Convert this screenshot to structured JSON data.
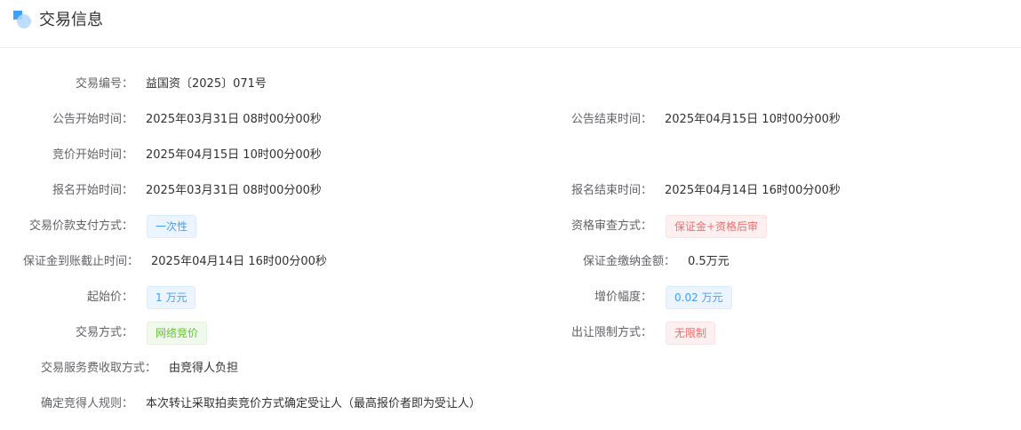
{
  "header": {
    "title": "交易信息",
    "icon": "section-block-icon",
    "accent": "#409eff"
  },
  "fields": {
    "trade_no": {
      "label": "交易编号：",
      "value": "益国资〔2025〕071号"
    },
    "notice_start": {
      "label": "公告开始时间：",
      "value": "2025年03月31日 08时00分00秒"
    },
    "notice_end": {
      "label": "公告结束时间：",
      "value": "2025年04月15日 10时00分00秒"
    },
    "bid_start": {
      "label": "竞价开始时间：",
      "value": "2025年04月15日 10时00分00秒"
    },
    "signup_start": {
      "label": "报名开始时间：",
      "value": "2025年03月31日 08时00分00秒"
    },
    "signup_end": {
      "label": "报名结束时间：",
      "value": "2025年04月14日 16时00分00秒"
    },
    "payment_method": {
      "label": "交易价款支付方式：",
      "value": "一次性"
    },
    "qualification_review": {
      "label": "资格审查方式：",
      "value": "保证金+资格后审"
    },
    "deposit_deadline": {
      "label": "保证金到账截止时间：",
      "value": "2025年04月14日 16时00分00秒"
    },
    "deposit_amount": {
      "label": "保证金缴纳金额：",
      "value": "0.5万元"
    },
    "start_price": {
      "label": "起始价：",
      "value": "1 万元"
    },
    "increment": {
      "label": "增价幅度：",
      "value": "0.02 万元"
    },
    "trade_method": {
      "label": "交易方式：",
      "value": "网络竞价"
    },
    "transfer_restriction": {
      "label": "出让限制方式：",
      "value": "无限制"
    },
    "service_fee": {
      "label": "交易服务费收取方式：",
      "value": "由竞得人负担"
    },
    "winner_rule": {
      "label": "确定竞得人规则：",
      "value": "本次转让采取拍卖竞价方式确定受让人（最高报价者即为受让人）"
    }
  }
}
